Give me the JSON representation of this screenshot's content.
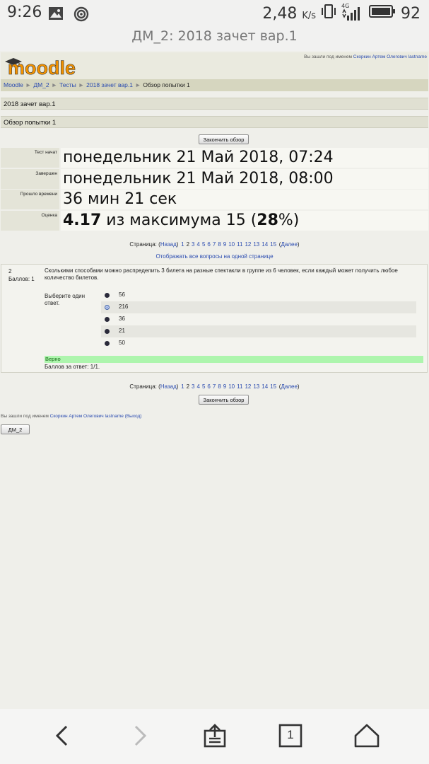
{
  "status_bar": {
    "time": "9:26",
    "speed": "2,48",
    "speed_unit": "K/s",
    "network": "4G",
    "battery": "92"
  },
  "browser": {
    "title": "ДМ_2: 2018 зачет вар.1"
  },
  "header": {
    "logo_text": "moodle",
    "logged_in_prefix": "Вы зашли под именем",
    "user_name": "Скоркин Артем Олегович lastname"
  },
  "breadcrumb": {
    "items": [
      "Moodle",
      "ДМ_2",
      "Тесты",
      "2018 зачет вар.1"
    ],
    "current": "Обзор попытки 1",
    "separator": "►"
  },
  "heading1": "2018 зачет вар.1",
  "heading2": "Обзор попытки 1",
  "finish_review_label": "Закончить обзор",
  "summary": {
    "started_label": "Тест начат",
    "started_value": "понедельник 21 Май 2018, 07:24",
    "completed_label": "Завершен",
    "completed_value": "понедельник 21 Май 2018, 08:00",
    "elapsed_label": "Прошло времени",
    "elapsed_value": "36 мин 21 сек",
    "grade_label": "Оценка",
    "grade_score": "4.17",
    "grade_middle": " из максимума 15 (",
    "grade_percent": "28",
    "grade_end": "%)"
  },
  "pagination": {
    "label": "Страница:",
    "prev_open": "(",
    "prev": "Назад",
    "prev_close": ")",
    "pages": [
      "1",
      "2",
      "3",
      "4",
      "5",
      "6",
      "7",
      "8",
      "9",
      "10",
      "11",
      "12",
      "13",
      "14",
      "15"
    ],
    "current_page": "2",
    "next_open": "(",
    "next": "Далее",
    "next_close": ")"
  },
  "show_all_link": "Отображать все вопросы на одной странице",
  "question": {
    "number": "2",
    "marks": "Баллов: 1",
    "text": "Сколькими способами можно распределить 3 билета на разные спектакли в группе из 6 человек, если каждый может получить любое количество билетов.",
    "prompt": "Выберите один ответ.",
    "options": [
      "56",
      "216",
      "36",
      "21",
      "50"
    ],
    "selected_option": "216",
    "feedback": "Верно",
    "points": "Баллов за ответ: 1/1."
  },
  "footer": {
    "logged_in_prefix": "Вы зашли под именем",
    "user_name": "Скоркин Артем Олегович lastname",
    "logout_label": "(Выход)",
    "course_button": "ДМ_2"
  },
  "bottom_nav": {
    "tab_count": "1"
  },
  "colors": {
    "link": "#2a4bb0",
    "correct_bg": "#adf5ad",
    "navbar_bg": "#d6d6bf",
    "logo_orange": "#f39200"
  }
}
